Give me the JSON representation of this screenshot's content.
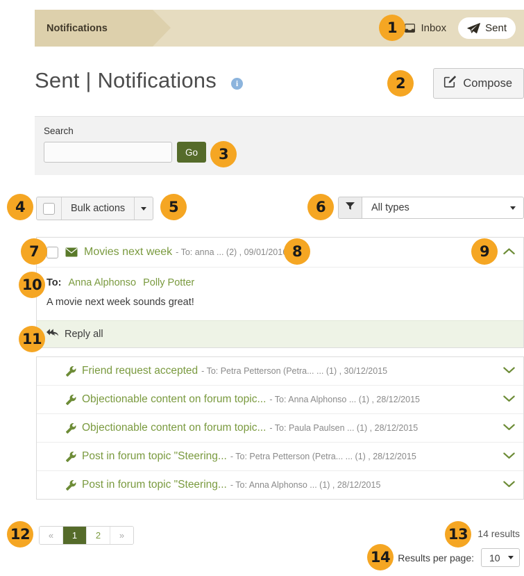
{
  "topbar": {
    "tab_label": "Notifications",
    "nav": [
      {
        "label": "Inbox",
        "icon": "inbox-icon",
        "active": false
      },
      {
        "label": "Sent",
        "icon": "paper-plane-icon",
        "active": true
      }
    ]
  },
  "header": {
    "title": "Sent | Notifications",
    "info_icon": "i",
    "compose_label": "Compose"
  },
  "search": {
    "label": "Search",
    "value": "",
    "placeholder": "",
    "go_label": "Go"
  },
  "controls": {
    "bulk_actions_label": "Bulk actions",
    "filter_value": "All types"
  },
  "messages": [
    {
      "title": "Movies next week",
      "meta": "- To: anna ... (2) , 09/01/2016",
      "icon": "envelope-icon",
      "expanded": true,
      "to_label": "To:",
      "recipients": [
        "Anna Alphonso",
        "Polly Potter"
      ],
      "body": "A movie next week sounds great!",
      "reply_all_label": "Reply all",
      "toggle_icon": "chevron-up-icon"
    }
  ],
  "notifications": [
    {
      "title": "Friend request accepted",
      "meta": "- To: Petra Petterson (Petra... ... (1) , 30/12/2015",
      "icon": "wrench-icon",
      "toggle_icon": "chevron-down-icon"
    },
    {
      "title": "Objectionable content on forum topic...",
      "meta": "- To: Anna Alphonso ... (1) , 28/12/2015",
      "icon": "wrench-icon",
      "toggle_icon": "chevron-down-icon"
    },
    {
      "title": "Objectionable content on forum topic...",
      "meta": "- To: Paula Paulsen ... (1) , 28/12/2015",
      "icon": "wrench-icon",
      "toggle_icon": "chevron-down-icon"
    },
    {
      "title": "Post in forum topic \"Steering...",
      "meta": "- To: Petra Petterson (Petra... ... (1) , 28/12/2015",
      "icon": "wrench-icon",
      "toggle_icon": "chevron-down-icon"
    },
    {
      "title": "Post in forum topic \"Steering...",
      "meta": "- To: Anna Alphonso ... (1) , 28/12/2015",
      "icon": "wrench-icon",
      "toggle_icon": "chevron-down-icon"
    }
  ],
  "pagination": {
    "first_label": "«",
    "pages": [
      "1",
      "2"
    ],
    "active_page": "1",
    "last_label": "»",
    "results_text": "14 results",
    "results_per_page_label": "Results per page:",
    "results_per_page_value": "10"
  },
  "callouts": [
    "1",
    "2",
    "3",
    "4",
    "5",
    "6",
    "7",
    "8",
    "9",
    "10",
    "11",
    "12",
    "13",
    "14"
  ],
  "colors": {
    "accent_green": "#7a9a3f",
    "button_green": "#556b2a",
    "topbar_bg": "#e6dcc0",
    "tab_bg": "#ddd0ac",
    "callout": "#f5a623",
    "info_blue": "#8cb4dd"
  }
}
